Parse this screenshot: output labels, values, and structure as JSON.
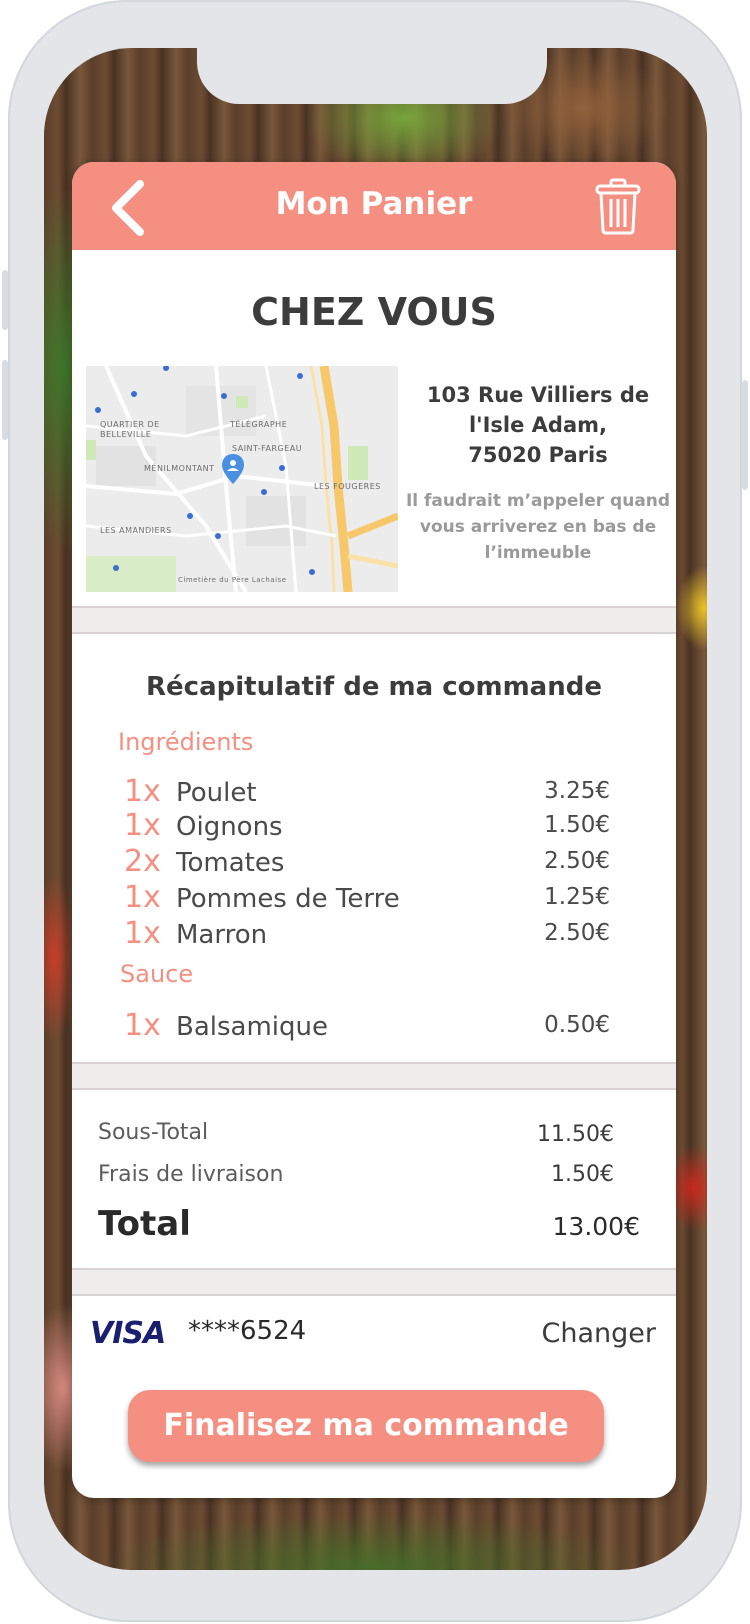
{
  "header": {
    "title": "Mon Panier",
    "back_icon": "chevron-left-icon",
    "trash_icon": "trash-icon"
  },
  "delivery": {
    "title": "CHEZ VOUS",
    "address_line1": "103 Rue Villiers de",
    "address_line2": "l'Isle Adam,",
    "address_line3": "75020 Paris",
    "note": "Il faudrait m’appeler quand vous arriverez en bas de l’immeuble",
    "map_labels": [
      "QUARTIER DE BELLEVILLE",
      "TÉLÉGRAPHE",
      "SAINT-FARGEAU",
      "MÉNILMONTANT",
      "LES FOUGERES",
      "LES AMANDIERS",
      "Cimetière du Père Lachaise"
    ]
  },
  "recap": {
    "title": "Récapitulatif de ma commande",
    "ingredients_label": "Ingrédients",
    "ingredients": [
      {
        "qty": "1x",
        "name": "Poulet",
        "price": "3.25€"
      },
      {
        "qty": "1x",
        "name": "Oignons",
        "price": "1.50€"
      },
      {
        "qty": "2x",
        "name": "Tomates",
        "price": "2.50€"
      },
      {
        "qty": "1x",
        "name": "Pommes de Terre",
        "price": "1.25€"
      },
      {
        "qty": "1x",
        "name": "Marron",
        "price": "2.50€"
      }
    ],
    "sauce_label": "Sauce",
    "sauces": [
      {
        "qty": "1x",
        "name": "Balsamique",
        "price": "0.50€"
      }
    ]
  },
  "summary": {
    "subtotal_label": "Sous-Total",
    "subtotal_value": "11.50€",
    "delivery_label": "Frais de livraison",
    "delivery_value": "1.50€",
    "total_label": "Total",
    "total_value": "13.00€"
  },
  "payment": {
    "brand": "VISA",
    "card_number": "****6524",
    "change_label": "Changer"
  },
  "cta": {
    "label": "Finalisez ma commande"
  },
  "colors": {
    "accent": "#f58f82",
    "text_dark": "#3c3c3c",
    "note_grey": "#9a9a9a",
    "visa_blue": "#1a1f71"
  }
}
